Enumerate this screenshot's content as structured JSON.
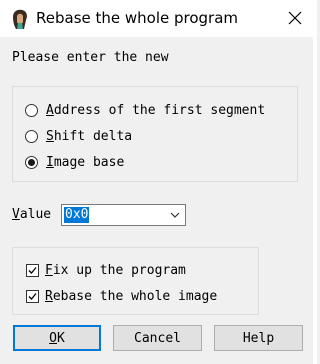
{
  "dialog": {
    "title": "Rebase the whole program",
    "prompt": "Please enter the new"
  },
  "mode": {
    "options": [
      {
        "accel": "A",
        "rest": "ddress of the first segment",
        "selected": false
      },
      {
        "accel": "S",
        "rest": "hift delta",
        "selected": false
      },
      {
        "accel": "I",
        "rest": "mage base",
        "selected": true
      }
    ]
  },
  "value": {
    "accel": "V",
    "rest": "alue",
    "current": "0x0"
  },
  "options": {
    "fixup": {
      "accel": "F",
      "rest": "ix up the program",
      "checked": true
    },
    "rebase_image": {
      "accel": "R",
      "rest": "ebase the whole image",
      "checked": true
    }
  },
  "buttons": {
    "ok": {
      "accel": "O",
      "rest": "K"
    },
    "cancel": "Cancel",
    "help": "Help"
  },
  "icons": {
    "app": "ida-pro-icon",
    "close": "close-icon",
    "dropdown": "chevron-down-icon",
    "checkmark": "checkmark-icon"
  },
  "colors": {
    "accent": "#0078d7",
    "dialog_bg": "#f0f0f0"
  }
}
